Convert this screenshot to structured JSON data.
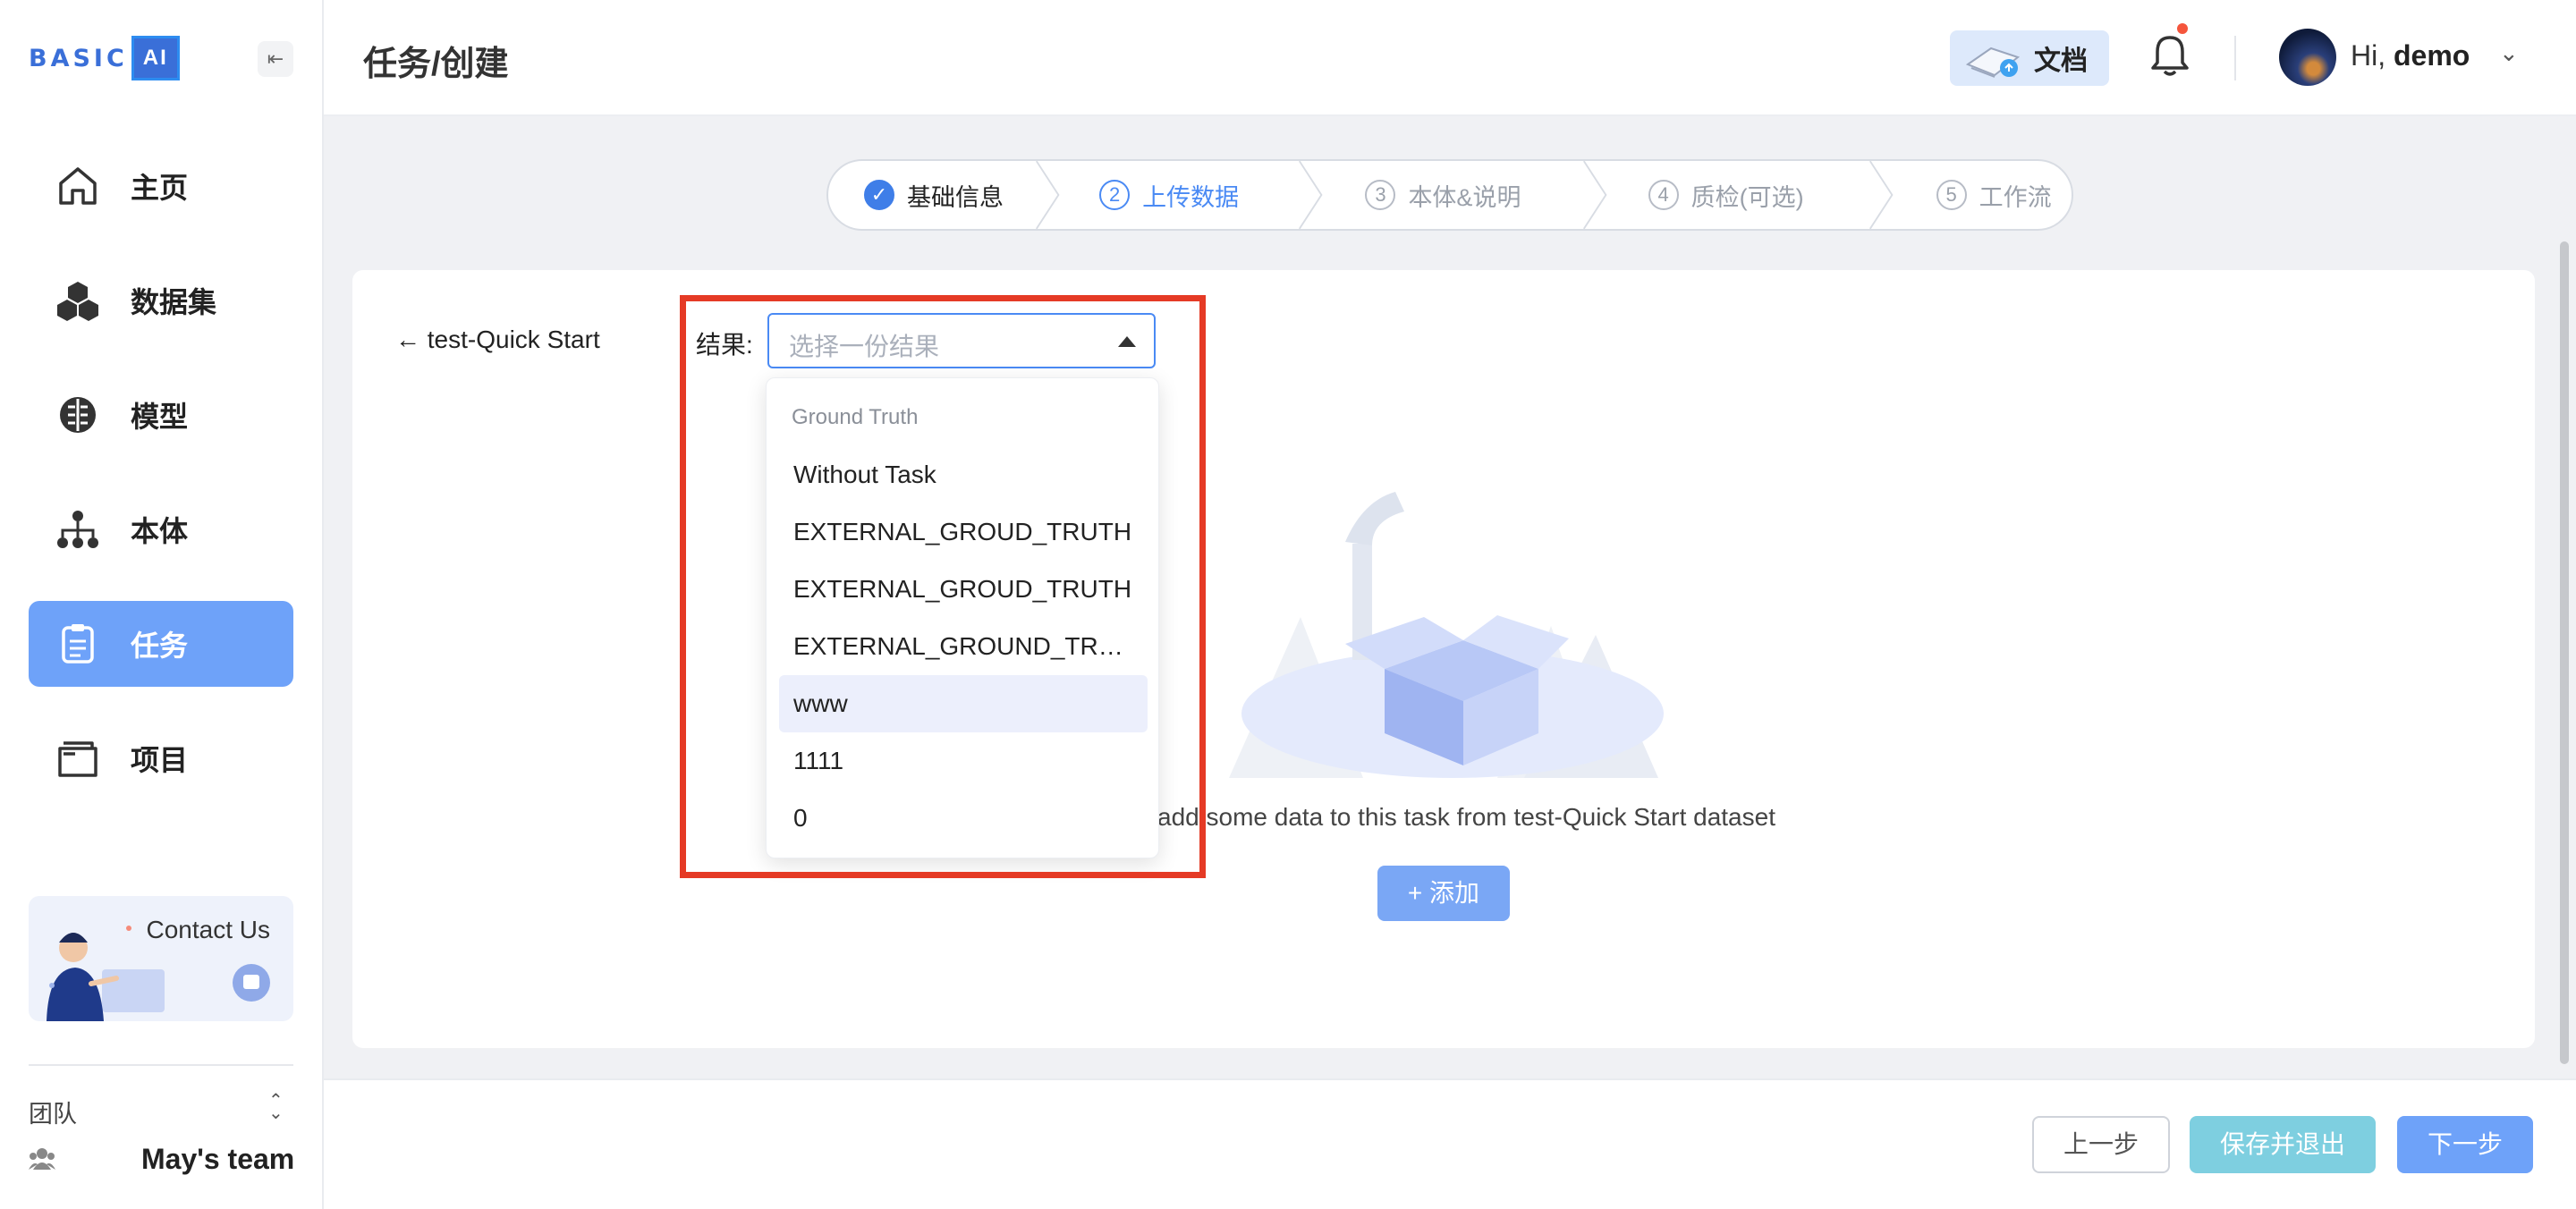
{
  "brand": {
    "logo_text": "BASIC",
    "logo_ai": "AI"
  },
  "sidebar": {
    "collapse_icon": "collapse-icon",
    "items": [
      {
        "label": "主页",
        "icon": "home-icon",
        "active": false
      },
      {
        "label": "数据集",
        "icon": "cubes-icon",
        "active": false
      },
      {
        "label": "模型",
        "icon": "brain-icon",
        "active": false
      },
      {
        "label": "本体",
        "icon": "hierarchy-icon",
        "active": false
      },
      {
        "label": "任务",
        "icon": "clipboard-icon",
        "active": true
      },
      {
        "label": "项目",
        "icon": "folder-icon",
        "active": false
      }
    ],
    "contact": {
      "label": "Contact Us",
      "icon": "chat-icon"
    },
    "team": {
      "label": "团队",
      "name": "May's team",
      "icon": "team-icon"
    }
  },
  "header": {
    "title": "任务/创建",
    "doc_label": "文档",
    "greeting_prefix": "Hi,",
    "username": "demo"
  },
  "steps": [
    {
      "num": "✓",
      "label": "基础信息",
      "state": "done"
    },
    {
      "num": "2",
      "label": "上传数据",
      "state": "current"
    },
    {
      "num": "3",
      "label": "本体&说明",
      "state": "todo"
    },
    {
      "num": "4",
      "label": "质检(可选)",
      "state": "todo"
    },
    {
      "num": "5",
      "label": "工作流",
      "state": "todo"
    }
  ],
  "main": {
    "back_label": "test-Quick Start",
    "result_label": "结果:",
    "select_placeholder": "选择一份结果",
    "empty_text": "add some data to this task from test-Quick Start dataset",
    "add_button": "+ 添加"
  },
  "dropdown": {
    "group": "Ground Truth",
    "options": [
      "Without Task",
      "EXTERNAL_GROUD_TRUTH",
      "EXTERNAL_GROUD_TRUTH",
      "EXTERNAL_GROUND_TRUTH",
      "www",
      "1111",
      "0"
    ],
    "highlighted_index": 4
  },
  "footer": {
    "prev": "上一步",
    "save_exit": "保存并退出",
    "next": "下一步"
  },
  "colors": {
    "accent": "#6ea2f9",
    "annotation": "#e53a25",
    "save": "#7ecfe0"
  }
}
